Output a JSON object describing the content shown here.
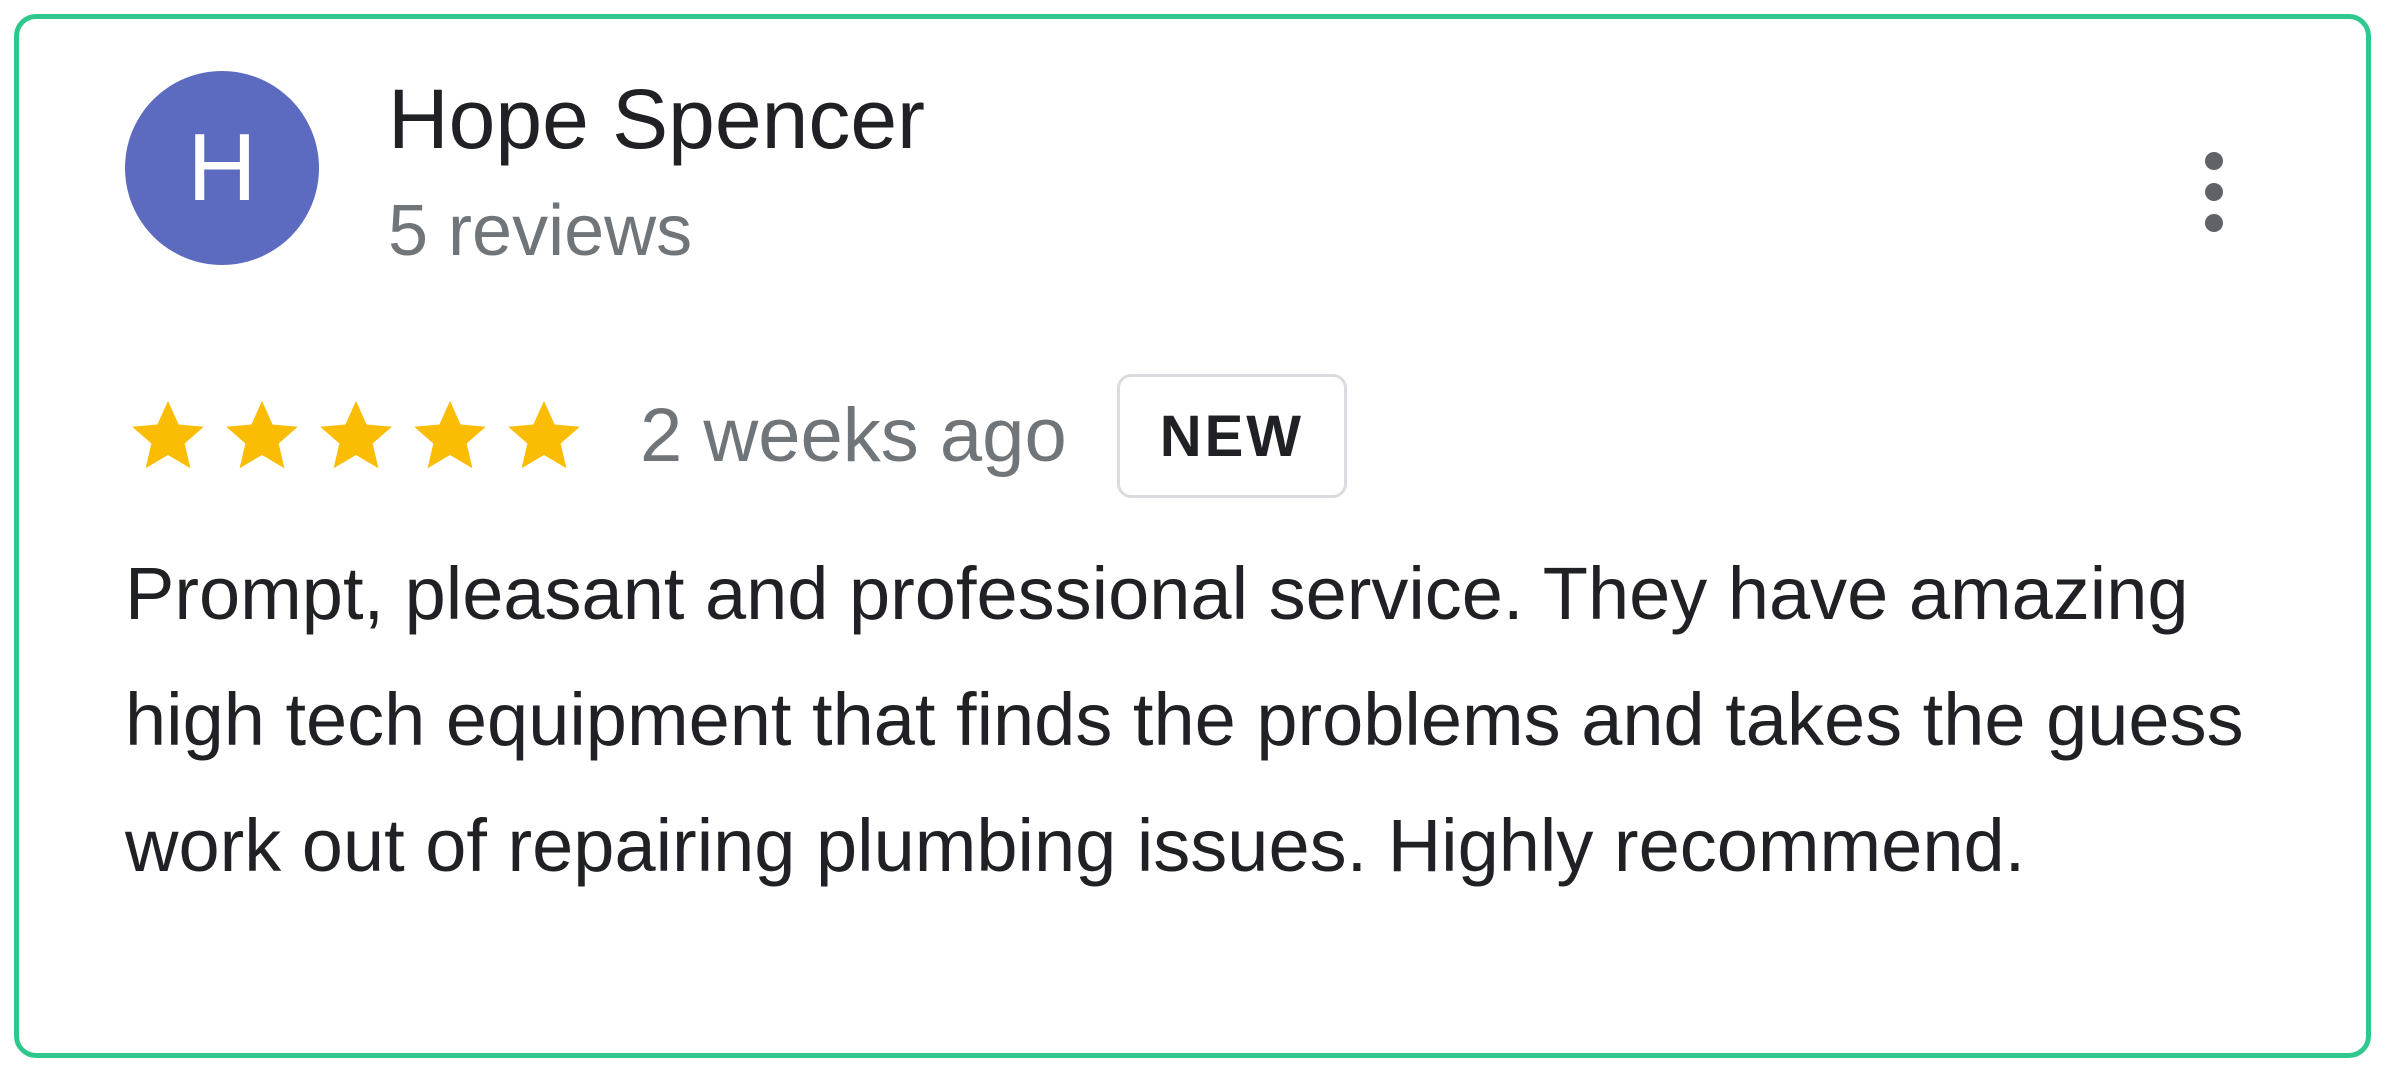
{
  "review": {
    "avatar_initial": "H",
    "author_name": "Hope Spencer",
    "review_count": "5 reviews",
    "rating": 5,
    "rating_max": 5,
    "time_ago": "2 weeks ago",
    "badge": "NEW",
    "text": "Prompt, pleasant and professional service. They have amazing high tech equipment that finds the problems and takes the guess work out of repairing plumbing issues. Highly recommend."
  },
  "icons": {
    "more": "more-vert-icon",
    "star": "star-icon"
  },
  "colors": {
    "card_border": "#2fc78d",
    "avatar_bg": "#5c6bc0",
    "star": "#fbbc04",
    "muted_text": "#70757a"
  }
}
